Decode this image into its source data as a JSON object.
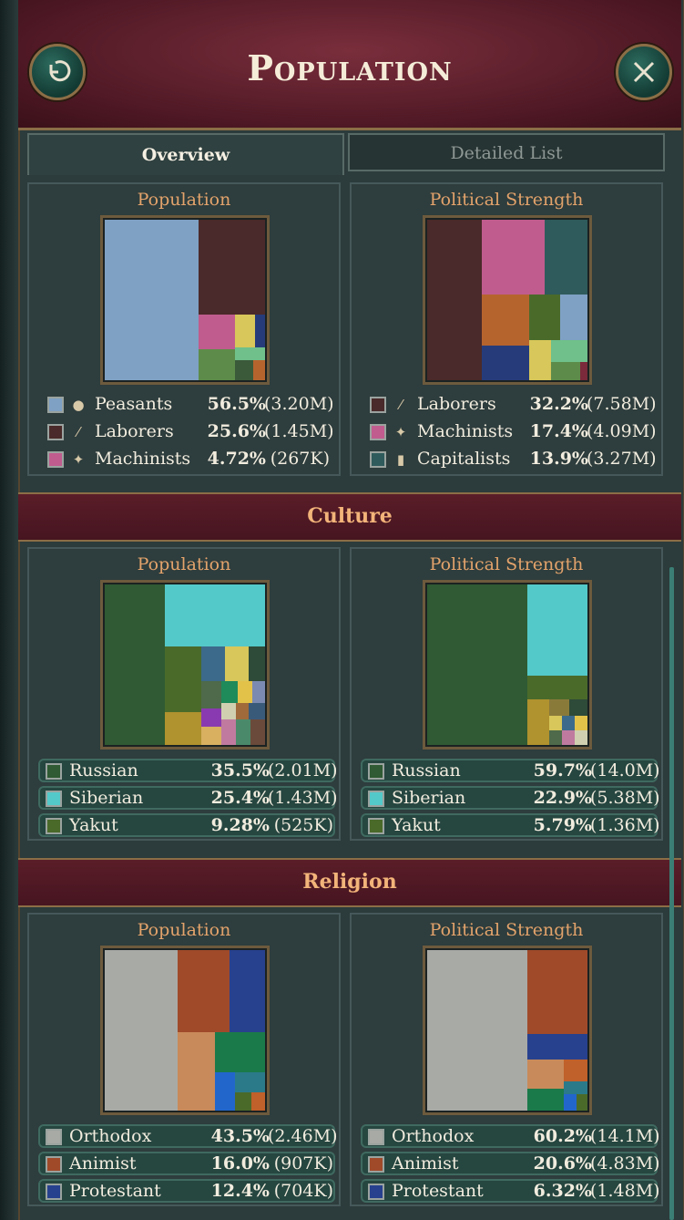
{
  "window": {
    "title": "Population"
  },
  "tabs": {
    "overview": "Overview",
    "detailed": "Detailed List"
  },
  "overview": {
    "population": {
      "title": "Population",
      "rows": [
        {
          "label": "Peasants",
          "pct": "56.5%",
          "abs": "(3.20M)",
          "color": "#7fa1c4",
          "icon": "sack-icon"
        },
        {
          "label": "Laborers",
          "pct": "25.6%",
          "abs": "(1.45M)",
          "color": "#4a2a2a",
          "icon": "shovel-icon"
        },
        {
          "label": "Machinists",
          "pct": "4.72%",
          "abs": "(267K)",
          "color": "#c05c8e",
          "icon": "wrench-icon"
        }
      ]
    },
    "political": {
      "title": "Political Strength",
      "rows": [
        {
          "label": "Laborers",
          "pct": "32.2%",
          "abs": "(7.58M)",
          "color": "#4a2a2a",
          "icon": "shovel-icon"
        },
        {
          "label": "Machinists",
          "pct": "17.4%",
          "abs": "(4.09M)",
          "color": "#c05c8e",
          "icon": "wrench-icon"
        },
        {
          "label": "Capitalists",
          "pct": "13.9%",
          "abs": "(3.27M)",
          "color": "#2f5b5c",
          "icon": "top-hat-icon"
        }
      ]
    }
  },
  "culture": {
    "title": "Culture",
    "population": {
      "title": "Population",
      "rows": [
        {
          "label": "Russian",
          "pct": "35.5%",
          "abs": "(2.01M)",
          "color": "#2f5a33"
        },
        {
          "label": "Siberian",
          "pct": "25.4%",
          "abs": "(1.43M)",
          "color": "#54c9c9"
        },
        {
          "label": "Yakut",
          "pct": "9.28%",
          "abs": "(525K)",
          "color": "#4a6a2a"
        }
      ]
    },
    "political": {
      "title": "Political Strength",
      "rows": [
        {
          "label": "Russian",
          "pct": "59.7%",
          "abs": "(14.0M)",
          "color": "#2f5a33"
        },
        {
          "label": "Siberian",
          "pct": "22.9%",
          "abs": "(5.38M)",
          "color": "#54c9c9"
        },
        {
          "label": "Yakut",
          "pct": "5.79%",
          "abs": "(1.36M)",
          "color": "#4a6a2a"
        }
      ]
    }
  },
  "religion": {
    "title": "Religion",
    "population": {
      "title": "Population",
      "rows": [
        {
          "label": "Orthodox",
          "pct": "43.5%",
          "abs": "(2.46M)",
          "color": "#a8aaa6"
        },
        {
          "label": "Animist",
          "pct": "16.0%",
          "abs": "(907K)",
          "color": "#a04a2a"
        },
        {
          "label": "Protestant",
          "pct": "12.4%",
          "abs": "(704K)",
          "color": "#27418e"
        }
      ]
    },
    "political": {
      "title": "Political Strength",
      "rows": [
        {
          "label": "Orthodox",
          "pct": "60.2%",
          "abs": "(14.1M)",
          "color": "#a8aaa6"
        },
        {
          "label": "Animist",
          "pct": "20.6%",
          "abs": "(4.83M)",
          "color": "#a04a2a"
        },
        {
          "label": "Protestant",
          "pct": "6.32%",
          "abs": "(1.48M)",
          "color": "#27418e"
        }
      ]
    }
  }
}
